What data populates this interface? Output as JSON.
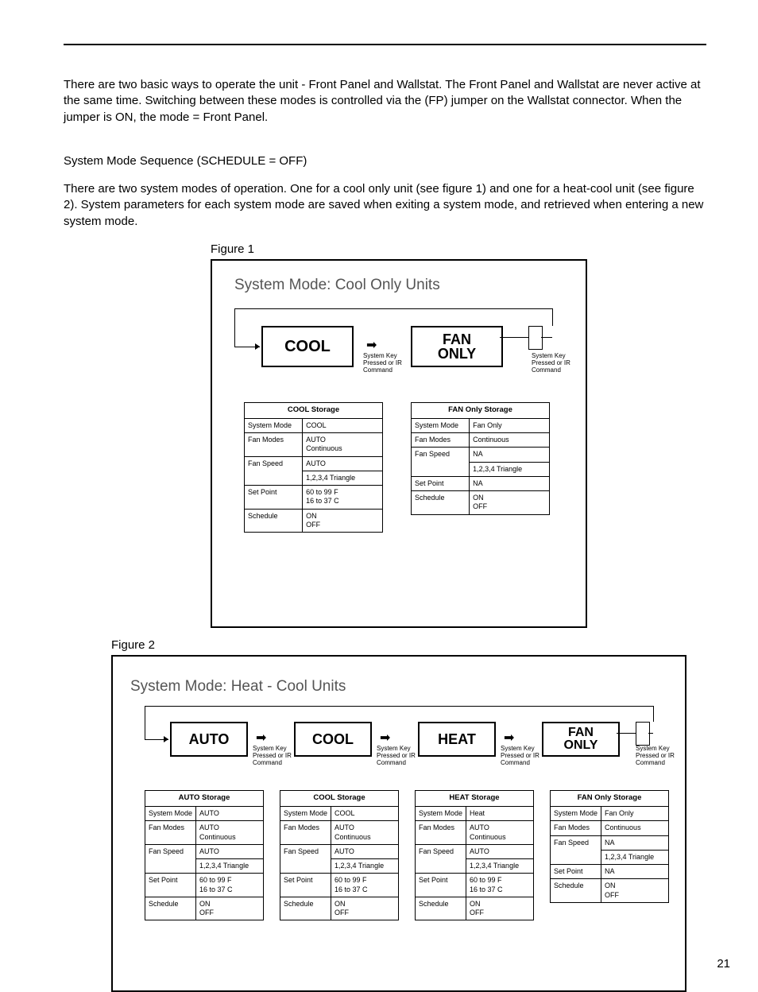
{
  "pageNumber": "21",
  "para1": "There are two basic ways to operate the unit - Front Panel and Wallstat. The Front Panel and Wallstat are never active at the same time. Switching between these modes is controlled via the (FP) jumper on the Wallstat connector. When the jumper is ON, the mode = Front Panel.",
  "heading2": "System Mode Sequence (SCHEDULE = OFF)",
  "para2": "There are two system modes of operation. One for a cool only unit (see figure 1) and one for a heat-cool unit (see figure 2). System parameters for each system mode are saved when exiting a system mode, and retrieved when entering a new system mode.",
  "fig1": {
    "label": "Figure 1",
    "title": "System Mode: Cool Only Units",
    "cool": "COOL",
    "fan": "FAN\nONLY",
    "caption": "System Key\nPressed or IR\nCommand",
    "coolStorage": {
      "title": "COOL Storage",
      "rows": [
        [
          "System Mode",
          "COOL"
        ],
        [
          "Fan Modes",
          "AUTO\nContinuous"
        ],
        [
          "Fan Speed",
          "AUTO"
        ],
        [
          "",
          "1,2,3,4 Triangle"
        ],
        [
          "Set Point",
          "60 to 99 F\n16 to 37 C"
        ],
        [
          "Schedule",
          "ON\nOFF"
        ]
      ]
    },
    "fanStorage": {
      "title": "FAN Only Storage",
      "rows": [
        [
          "System Mode",
          "Fan Only"
        ],
        [
          "Fan Modes",
          "Continuous"
        ],
        [
          "Fan Speed",
          "NA"
        ],
        [
          "",
          "1,2,3,4 Triangle"
        ],
        [
          "Set Point",
          "NA"
        ],
        [
          "Schedule",
          "ON\nOFF"
        ]
      ]
    }
  },
  "fig2": {
    "label": "Figure 2",
    "title": "System Mode: Heat - Cool Units",
    "auto": "AUTO",
    "cool": "COOL",
    "heat": "HEAT",
    "fan": "FAN\nONLY",
    "caption": "System Key\nPressed or IR\nCommand",
    "autoStorage": {
      "title": "AUTO Storage",
      "rows": [
        [
          "System Mode",
          "AUTO"
        ],
        [
          "Fan Modes",
          "AUTO\nContinuous"
        ],
        [
          "Fan Speed",
          "AUTO"
        ],
        [
          "",
          "1,2,3,4 Triangle"
        ],
        [
          "Set Point",
          "60 to 99 F\n16 to 37 C"
        ],
        [
          "Schedule",
          "ON\nOFF"
        ]
      ]
    },
    "coolStorage": {
      "title": "COOL Storage",
      "rows": [
        [
          "System Mode",
          "COOL"
        ],
        [
          "Fan Modes",
          "AUTO\nContinuous"
        ],
        [
          "Fan Speed",
          "AUTO"
        ],
        [
          "",
          "1,2,3,4 Triangle"
        ],
        [
          "Set Point",
          "60 to 99 F\n16 to 37 C"
        ],
        [
          "Schedule",
          "ON\nOFF"
        ]
      ]
    },
    "heatStorage": {
      "title": "HEAT Storage",
      "rows": [
        [
          "System Mode",
          "Heat"
        ],
        [
          "Fan Modes",
          "AUTO\nContinuous"
        ],
        [
          "Fan Speed",
          "AUTO"
        ],
        [
          "",
          "1,2,3,4 Triangle"
        ],
        [
          "Set Point",
          "60 to 99 F\n16 to 37 C"
        ],
        [
          "Schedule",
          "ON\nOFF"
        ]
      ]
    },
    "fanStorage": {
      "title": "FAN Only Storage",
      "rows": [
        [
          "System Mode",
          "Fan Only"
        ],
        [
          "Fan Modes",
          "Continuous"
        ],
        [
          "Fan Speed",
          "NA"
        ],
        [
          "",
          "1,2,3,4 Triangle"
        ],
        [
          "Set Point",
          "NA"
        ],
        [
          "Schedule",
          "ON\nOFF"
        ]
      ]
    }
  }
}
